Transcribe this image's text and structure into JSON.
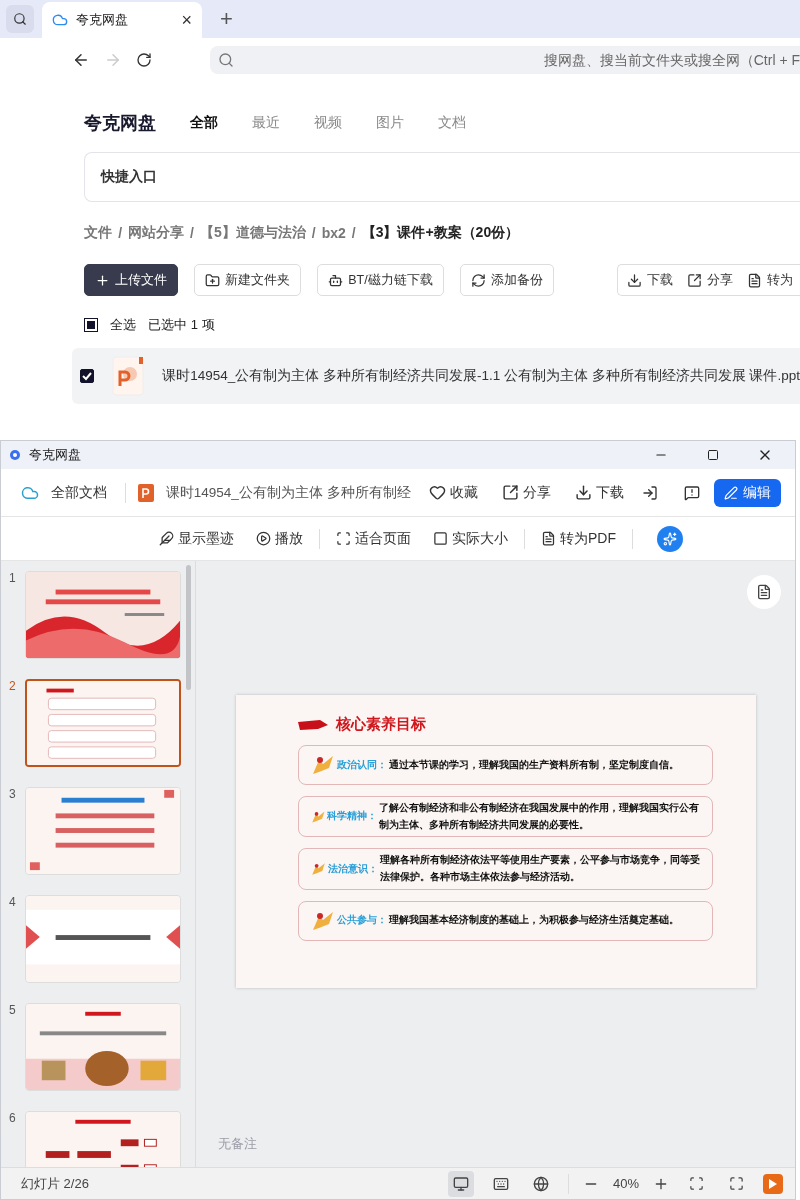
{
  "browser": {
    "tab": {
      "title": "夸克网盘",
      "close": "×"
    },
    "new_tab": "+",
    "search": {
      "placeholder": "搜网盘、搜当前文件夹或搜全网（Ctrl + F"
    }
  },
  "drive": {
    "brand": "夸克网盘",
    "tabs": [
      {
        "label": "全部",
        "selected": true
      },
      {
        "label": "最近",
        "selected": false
      },
      {
        "label": "视频",
        "selected": false
      },
      {
        "label": "图片",
        "selected": false
      },
      {
        "label": "文档",
        "selected": false
      }
    ],
    "quick_entry": "快捷入口",
    "breadcrumb": {
      "separator": "/",
      "items": [
        "文件",
        "网站分享",
        "【5】道德与法治",
        "bx2",
        "【3】课件+教案（20份）"
      ]
    },
    "actions": [
      {
        "kind": "upload",
        "label": "上传文件"
      },
      {
        "kind": "folder",
        "label": "新建文件夹"
      },
      {
        "kind": "bt",
        "label": "BT/磁力链下载"
      },
      {
        "kind": "backup",
        "label": "添加备份"
      }
    ],
    "file_actions": [
      {
        "kind": "download",
        "label": "下载"
      },
      {
        "kind": "share",
        "label": "分享"
      },
      {
        "kind": "pdf",
        "label": "转为"
      }
    ],
    "select_all": {
      "label": "全选",
      "indeterminate": true,
      "status": "已选中 1 项"
    },
    "files": [
      {
        "kind": "ppt",
        "name": "课时14954_公有制为主体 多种所有制经济共同发展-1.1 公有制为主体 多种所有制经济共同发展 课件.ppt",
        "checked": true
      }
    ]
  },
  "viewer": {
    "title": "夸克网盘",
    "all_docs": "全部文档",
    "file_title": "课时14954_公有制为主体 多种所有制经",
    "actions": [
      {
        "kind": "favorite",
        "label": "收藏"
      },
      {
        "kind": "share",
        "label": "分享"
      },
      {
        "kind": "download",
        "label": "下载"
      }
    ],
    "edit": "编辑",
    "tools": [
      {
        "kind": "ink",
        "label": "显示墨迹"
      },
      {
        "kind": "play",
        "label": "播放"
      },
      {
        "kind": "fit",
        "label": "适合页面"
      },
      {
        "kind": "actual",
        "label": "实际大小"
      },
      {
        "kind": "pdf",
        "label": "转为PDF"
      }
    ],
    "slides": [
      {
        "number": "1",
        "selected": false
      },
      {
        "number": "2",
        "selected": true
      },
      {
        "number": "3",
        "selected": false
      },
      {
        "number": "4",
        "selected": false
      },
      {
        "number": "5",
        "selected": false
      },
      {
        "number": "6",
        "selected": false
      }
    ],
    "slide": {
      "title": "核心素养目标",
      "items": [
        {
          "label": "政治认同：",
          "text": "通过本节课的学习，理解我国的生产资料所有制，坚定制度自信。"
        },
        {
          "label": "科学精神：",
          "text": "了解公有制经济和非公有制经济在我国发展中的作用，理解我国实行公有制为主体、多种所有制经济共同发展的必要性。"
        },
        {
          "label": "法治意识：",
          "text": "理解各种所有制经济依法平等使用生产要素，公平参与市场竞争，同等受法律保护。各种市场主体依法参与经济活动。"
        },
        {
          "label": "公共参与：",
          "text": "理解我国基本经济制度的基础上，为积极参与经济生活奠定基础。"
        }
      ]
    },
    "notes": "无备注",
    "status": {
      "slide": "幻灯片 2/26",
      "zoom": "40%"
    }
  }
}
